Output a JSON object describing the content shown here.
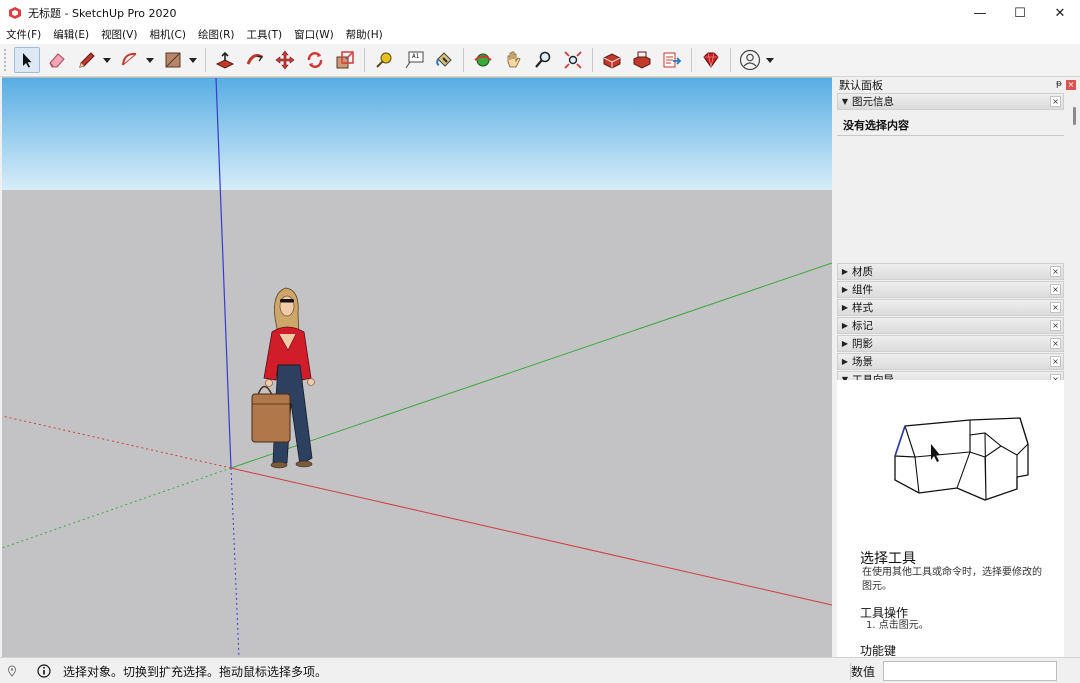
{
  "window": {
    "title": "无标题 - SketchUp Pro 2020",
    "minimize_glyph": "—",
    "maximize_glyph": "☐",
    "close_glyph": "✕"
  },
  "menu": [
    {
      "label": "文件(F)"
    },
    {
      "label": "编辑(E)"
    },
    {
      "label": "视图(V)"
    },
    {
      "label": "相机(C)"
    },
    {
      "label": "绘图(R)"
    },
    {
      "label": "工具(T)"
    },
    {
      "label": "窗口(W)"
    },
    {
      "label": "帮助(H)"
    }
  ],
  "toolbar": {
    "tools": [
      "select-icon",
      "eraser-icon",
      "pencil-icon",
      "arc-icon",
      "rectangle-icon",
      "push-pull-icon",
      "follow-me-icon",
      "move-icon",
      "rotate-icon",
      "scale-icon",
      "tape-measure-icon",
      "text-icon",
      "paint-bucket-icon",
      "orbit-icon",
      "pan-icon",
      "zoom-icon",
      "zoom-extents-icon",
      "warehouse-icon",
      "extension-warehouse-icon",
      "layout-icon",
      "ruby-icon",
      "account-icon"
    ],
    "text_tool_label": "A1"
  },
  "tray": {
    "title": "默认面板",
    "pin_glyph": "ᵽ",
    "close_glyph": "×",
    "entity_info": {
      "label": "图元信息",
      "content": "没有选择内容"
    },
    "panels": [
      {
        "label": "材质"
      },
      {
        "label": "组件"
      },
      {
        "label": "样式"
      },
      {
        "label": "标记"
      },
      {
        "label": "阴影"
      },
      {
        "label": "场景"
      }
    ],
    "instructor": {
      "label": "工具向导",
      "tool_title": "选择工具",
      "tool_desc": "在使用其他工具或命令时，选择要修改的图元。",
      "ops_title": "工具操作",
      "ops_step": "1. 点击图元。",
      "keys_title": "功能键",
      "keys_partial": "..."
    }
  },
  "status": {
    "message": "选择对象。切换到扩充选择。拖动鼠标选择多项。",
    "measure_label": "数值",
    "measure_value": ""
  },
  "colors": {
    "sky_top": "#5aaee3",
    "sky_bottom": "#d6ecf8",
    "ground": "#c3c3c6",
    "axis_red": "#d23a3a",
    "axis_green": "#3ba83b",
    "axis_blue": "#3a3ad0"
  }
}
